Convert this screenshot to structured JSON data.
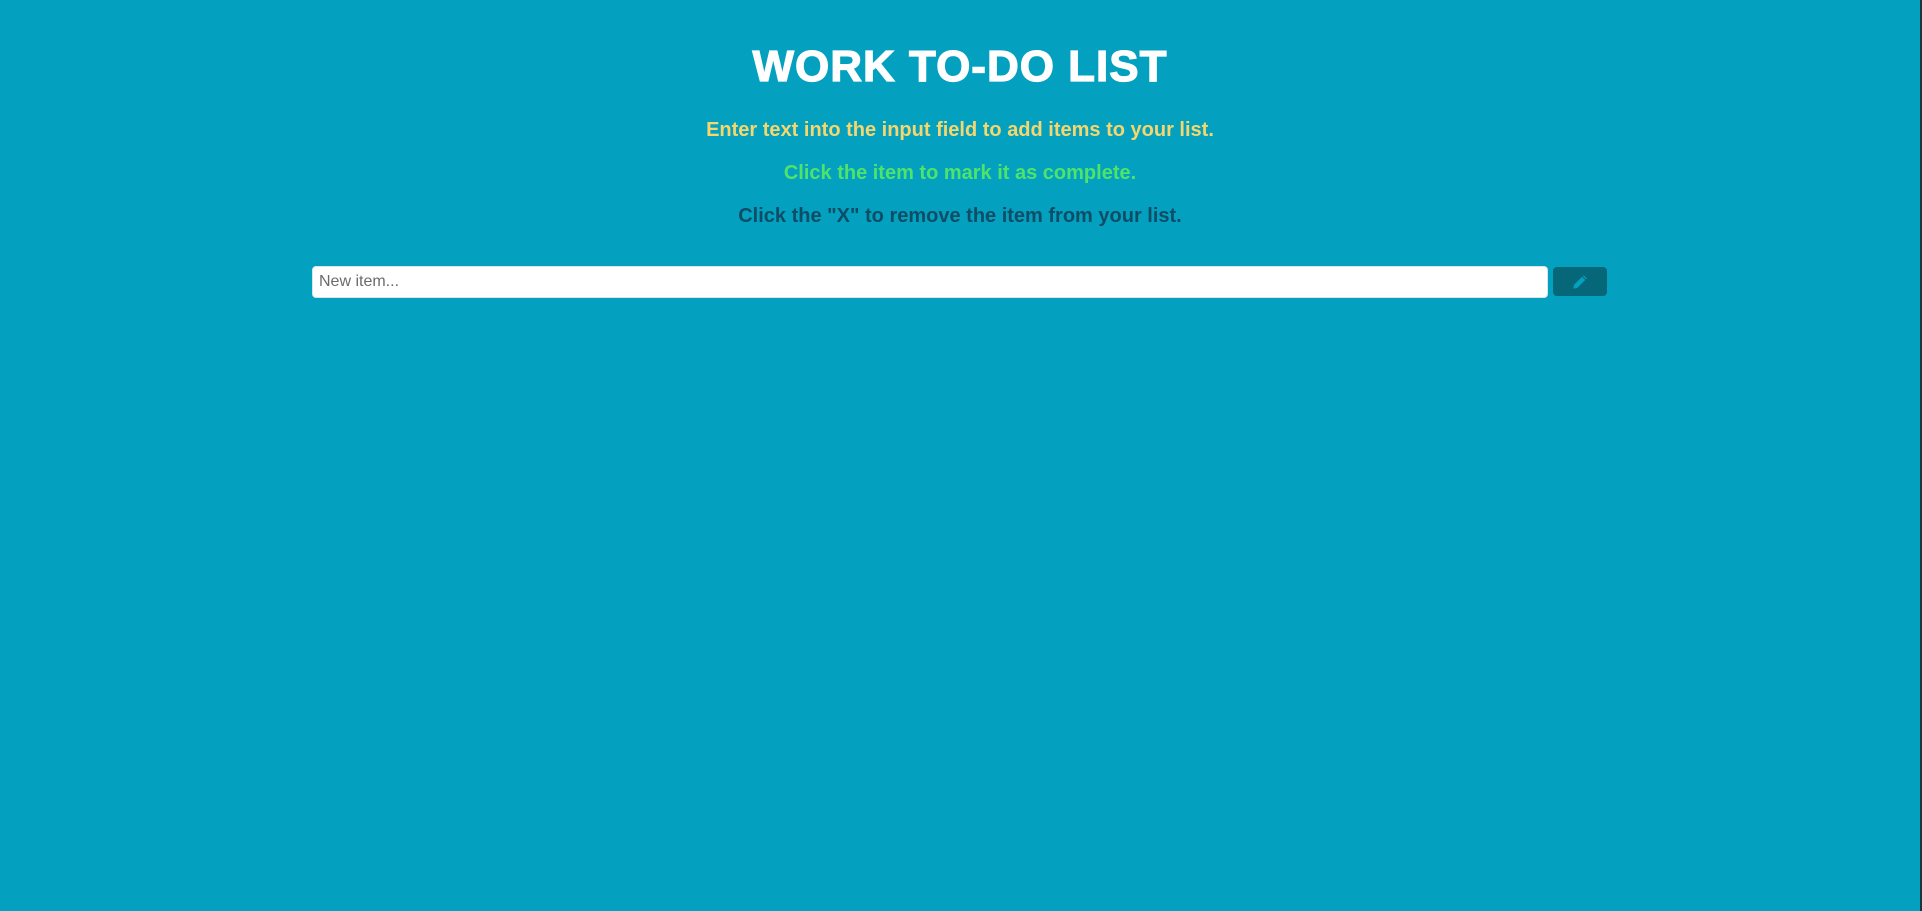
{
  "header": {
    "title": "WORK TO-DO LIST"
  },
  "instructions": [
    "Enter text into the input field to add items to your list.",
    "Click the item to mark it as complete.",
    "Click the \"X\" to remove the item from your list."
  ],
  "new_item": {
    "placeholder": "New item...",
    "value": "",
    "add_button_icon": "pencil-icon"
  },
  "colors": {
    "background": "#03a1bf",
    "title": "#ffffff",
    "instruction_1": "#f5d76e",
    "instruction_2": "#4ee36a",
    "instruction_3": "#0e4d66",
    "button": "#066779",
    "button_icon": "#03a1bf"
  }
}
